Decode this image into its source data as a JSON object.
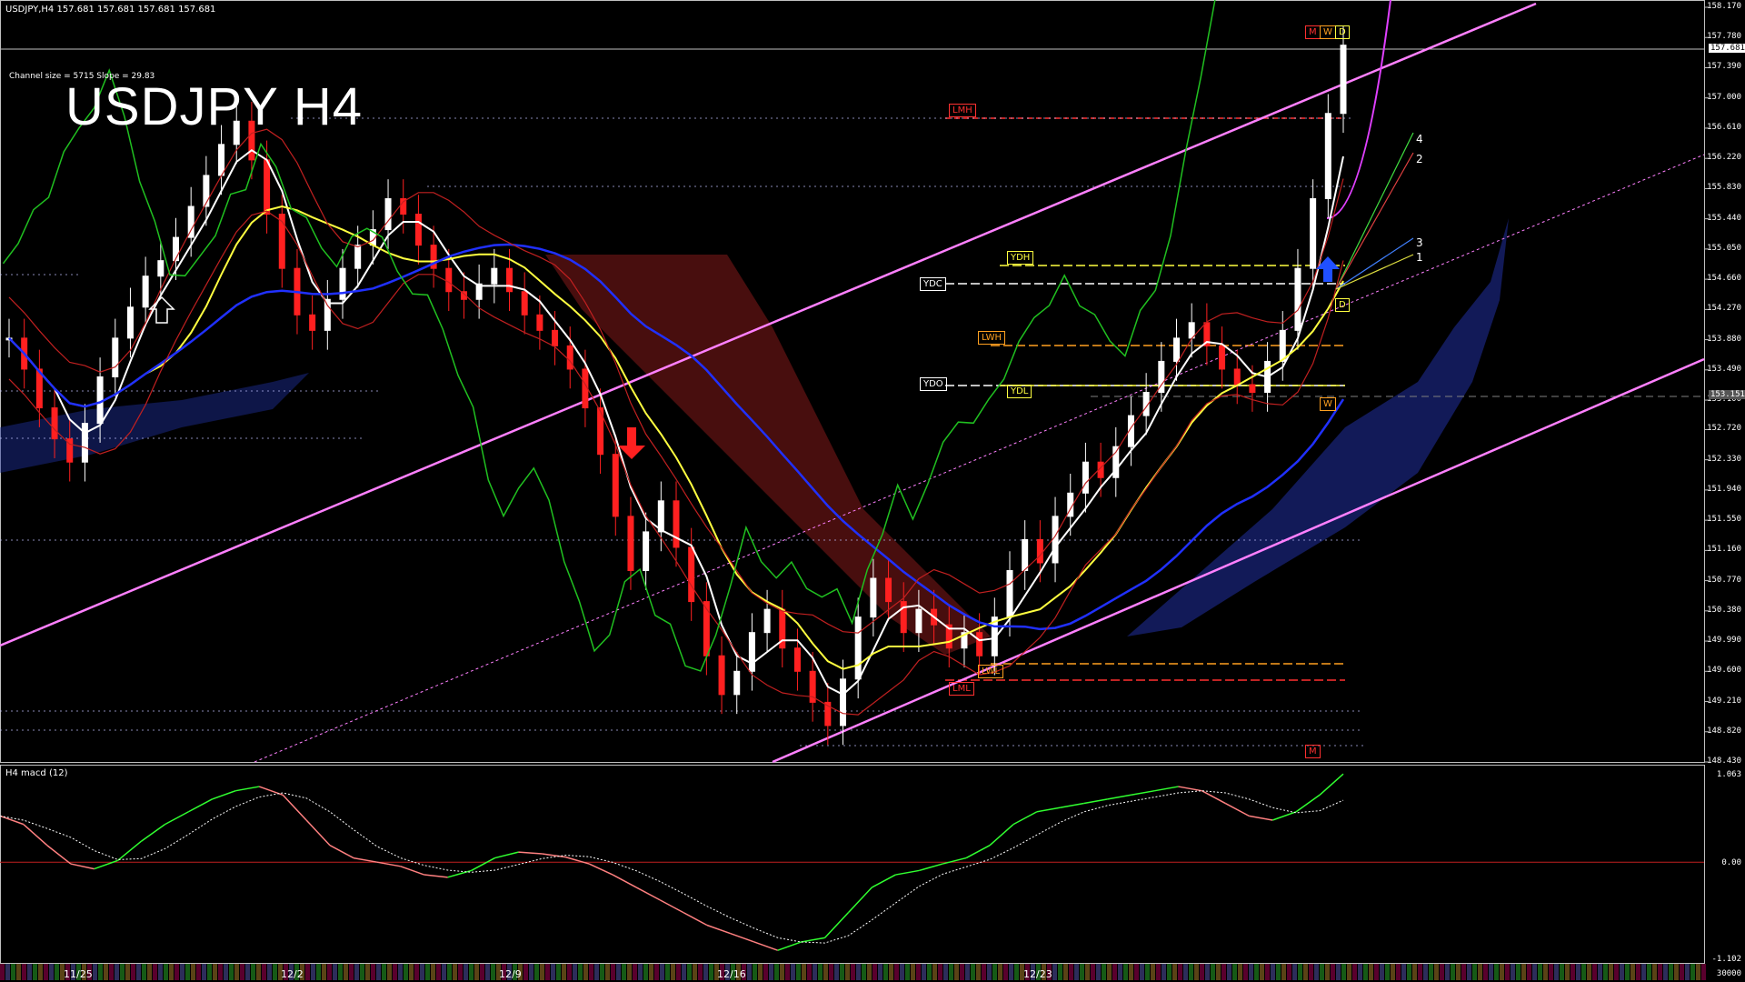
{
  "header": {
    "symbol_line": "USDJPY,H4  157.681 157.681 157.681 157.681",
    "channel_info": "Channel size = 5715 Slope = 29.83",
    "title": "USDJPY H4"
  },
  "macd_panel": {
    "label": "H4 macd (12)",
    "top_value": "1.063",
    "zero_value": "0.00",
    "bottom_value": "-1.102",
    "scale_value": "30000"
  },
  "price_axis": [
    "158.170",
    "157.780",
    "157.390",
    "157.000",
    "156.610",
    "156.220",
    "155.830",
    "155.440",
    "155.050",
    "154.660",
    "154.270",
    "153.880",
    "153.490",
    "153.100",
    "152.720",
    "152.330",
    "151.940",
    "151.550",
    "151.160",
    "150.770",
    "150.380",
    "149.990",
    "149.600",
    "149.210",
    "148.820",
    "148.430"
  ],
  "current_price_tag": "157.681",
  "grey_price_tag": "153.151",
  "date_labels": [
    "11/25",
    "12/2",
    "12/9",
    "12/16",
    "12/23"
  ],
  "level_labels": {
    "lmh": "LMH",
    "ydh": "YDH",
    "ydc": "YDC",
    "lwh": "LWH",
    "ydo": "YDO",
    "ydl": "YDL",
    "lwl": "LWL",
    "lml": "LML",
    "m": "M",
    "w": "W",
    "d": "D"
  },
  "fan_labels": [
    "4",
    "2",
    "3",
    "1"
  ],
  "colors": {
    "background": "#000000",
    "bull": "#ffffff",
    "bear": "#ff2020",
    "channel": "#ff80ff",
    "ma_blue": "#2030ff",
    "ma_yellow": "#ffff40",
    "ma_white": "#ffffff",
    "chikou": "#20c020",
    "kumo_red": "#c02020",
    "kumo_blue": "#3040c0",
    "macd_up": "#30ff30",
    "macd_down": "#ff8080"
  },
  "chart_data": {
    "type": "candlestick",
    "title": "USDJPY H4",
    "y_range": [
      148.43,
      158.17
    ],
    "x_labels": [
      "11/25",
      "12/2",
      "12/9",
      "12/16",
      "12/23"
    ],
    "close_series": [
      153.9,
      153.5,
      153.0,
      152.6,
      152.3,
      152.8,
      153.4,
      153.9,
      154.3,
      154.7,
      154.9,
      155.2,
      155.6,
      156.0,
      156.4,
      156.7,
      156.2,
      155.5,
      154.8,
      154.2,
      154.0,
      154.4,
      154.8,
      155.1,
      155.3,
      155.7,
      155.5,
      155.1,
      154.8,
      154.5,
      154.4,
      154.6,
      154.8,
      154.5,
      154.2,
      154.0,
      153.8,
      153.5,
      153.0,
      152.4,
      151.6,
      150.9,
      151.4,
      151.8,
      151.2,
      150.5,
      149.8,
      149.3,
      149.6,
      150.1,
      150.4,
      149.9,
      149.6,
      149.2,
      148.9,
      149.5,
      150.3,
      150.8,
      150.5,
      150.1,
      150.4,
      150.2,
      149.9,
      150.1,
      149.8,
      150.3,
      150.9,
      151.3,
      151.0,
      151.6,
      151.9,
      152.3,
      152.1,
      152.5,
      152.9,
      153.2,
      153.6,
      153.9,
      154.1,
      153.8,
      153.5,
      153.3,
      153.2,
      153.6,
      154.0,
      154.8,
      155.7,
      156.8,
      157.681
    ],
    "macd_series": [
      0.55,
      0.45,
      0.2,
      -0.02,
      -0.08,
      0.02,
      0.25,
      0.45,
      0.6,
      0.75,
      0.85,
      0.9,
      0.8,
      0.5,
      0.2,
      0.05,
      0.0,
      -0.05,
      -0.15,
      -0.18,
      -0.1,
      0.05,
      0.12,
      0.1,
      0.06,
      -0.02,
      -0.15,
      -0.3,
      -0.45,
      -0.6,
      -0.75,
      -0.85,
      -0.95,
      -1.05,
      -0.95,
      -0.9,
      -0.6,
      -0.3,
      -0.15,
      -0.1,
      -0.02,
      0.05,
      0.2,
      0.45,
      0.6,
      0.65,
      0.7,
      0.75,
      0.8,
      0.85,
      0.9,
      0.85,
      0.7,
      0.55,
      0.5,
      0.6,
      0.8,
      1.05
    ]
  }
}
